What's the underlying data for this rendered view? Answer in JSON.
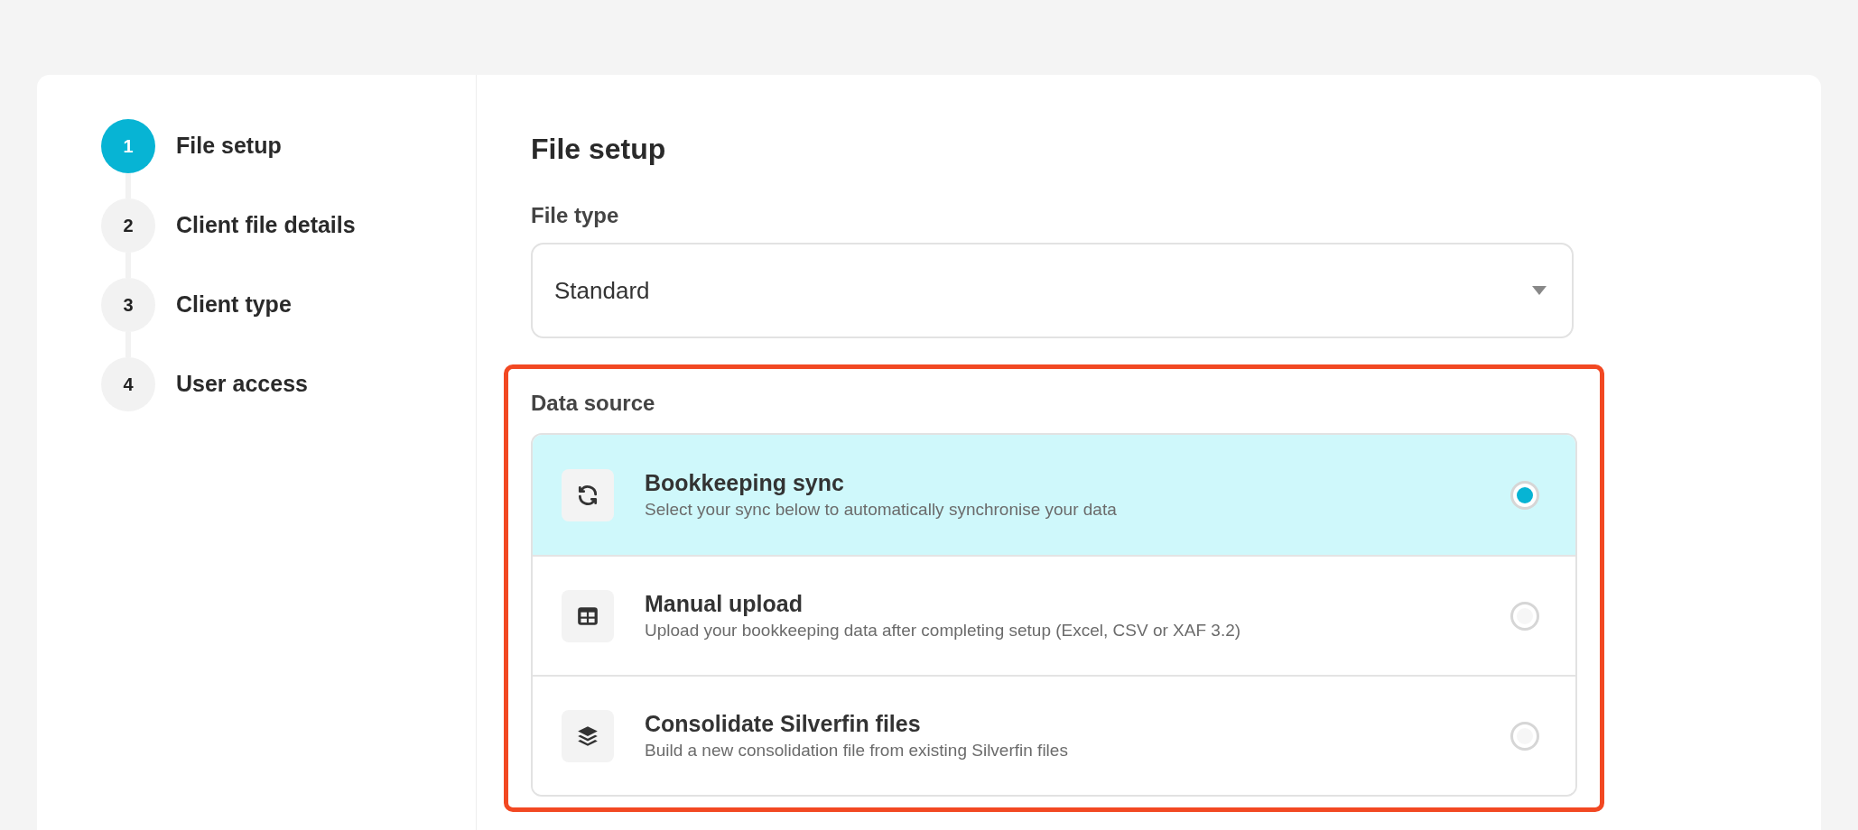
{
  "steps": [
    {
      "number": "1",
      "label": "File setup",
      "selected": true
    },
    {
      "number": "2",
      "label": "Client file details",
      "selected": false
    },
    {
      "number": "3",
      "label": "Client type",
      "selected": false
    },
    {
      "number": "4",
      "label": "User access",
      "selected": false
    }
  ],
  "title": "File setup",
  "file_type": {
    "label": "File type",
    "value": "Standard"
  },
  "data_source": {
    "label": "Data source",
    "highlighted": true,
    "options": [
      {
        "kind": "sync",
        "title": "Bookkeeping sync",
        "description": "Select your sync below to automatically synchronise your data",
        "selected": true
      },
      {
        "kind": "upload",
        "title": "Manual upload",
        "description": "Upload your bookkeeping data after completing setup (Excel, CSV or XAF 3.2)",
        "selected": false
      },
      {
        "kind": "consolidate",
        "title": "Consolidate Silverfin files",
        "description": "Build a new consolidation file from existing Silverfin files",
        "selected": false
      }
    ]
  }
}
